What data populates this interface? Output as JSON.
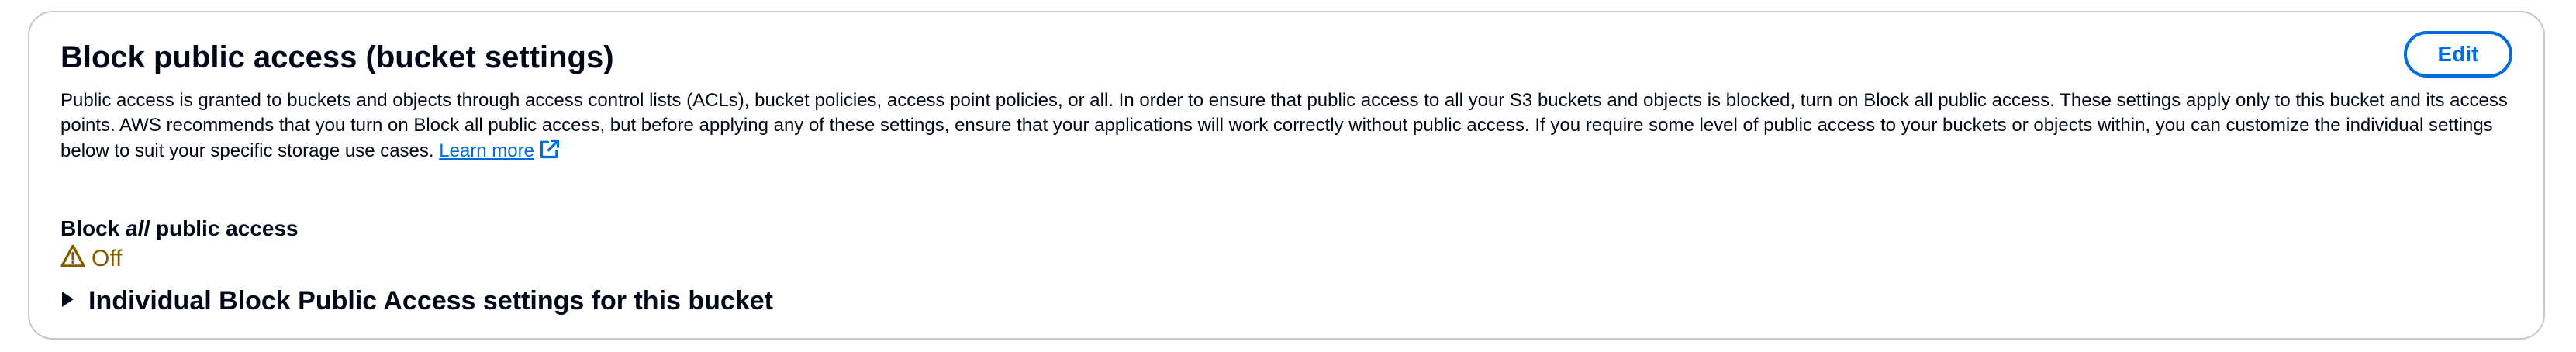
{
  "panel": {
    "title": "Block public access (bucket settings)",
    "edit_label": "Edit",
    "description": "Public access is granted to buckets and objects through access control lists (ACLs), bucket policies, access point policies, or all. In order to ensure that public access to all your S3 buckets and objects is blocked, turn on Block all public access. These settings apply only to this bucket and its access points. AWS recommends that you turn on Block all public access, but before applying any of these settings, ensure that your applications will work correctly without public access. If you require some level of public access to your buckets or objects within, you can customize the individual settings below to suit your specific storage use cases.",
    "learn_more_label": "Learn more",
    "learn_more_icon": "external-link-icon"
  },
  "block_all": {
    "label_prefix": "Block",
    "label_emphasis": "all",
    "label_suffix": "public access",
    "status_icon": "warning-icon",
    "status_text": "Off",
    "status_color": "#855900"
  },
  "individual_settings": {
    "icon": "caret-right-icon",
    "label": "Individual Block Public Access settings for this bucket"
  },
  "colors": {
    "accent": "#006ce0",
    "text": "#000716",
    "border": "#c6c6cd"
  }
}
